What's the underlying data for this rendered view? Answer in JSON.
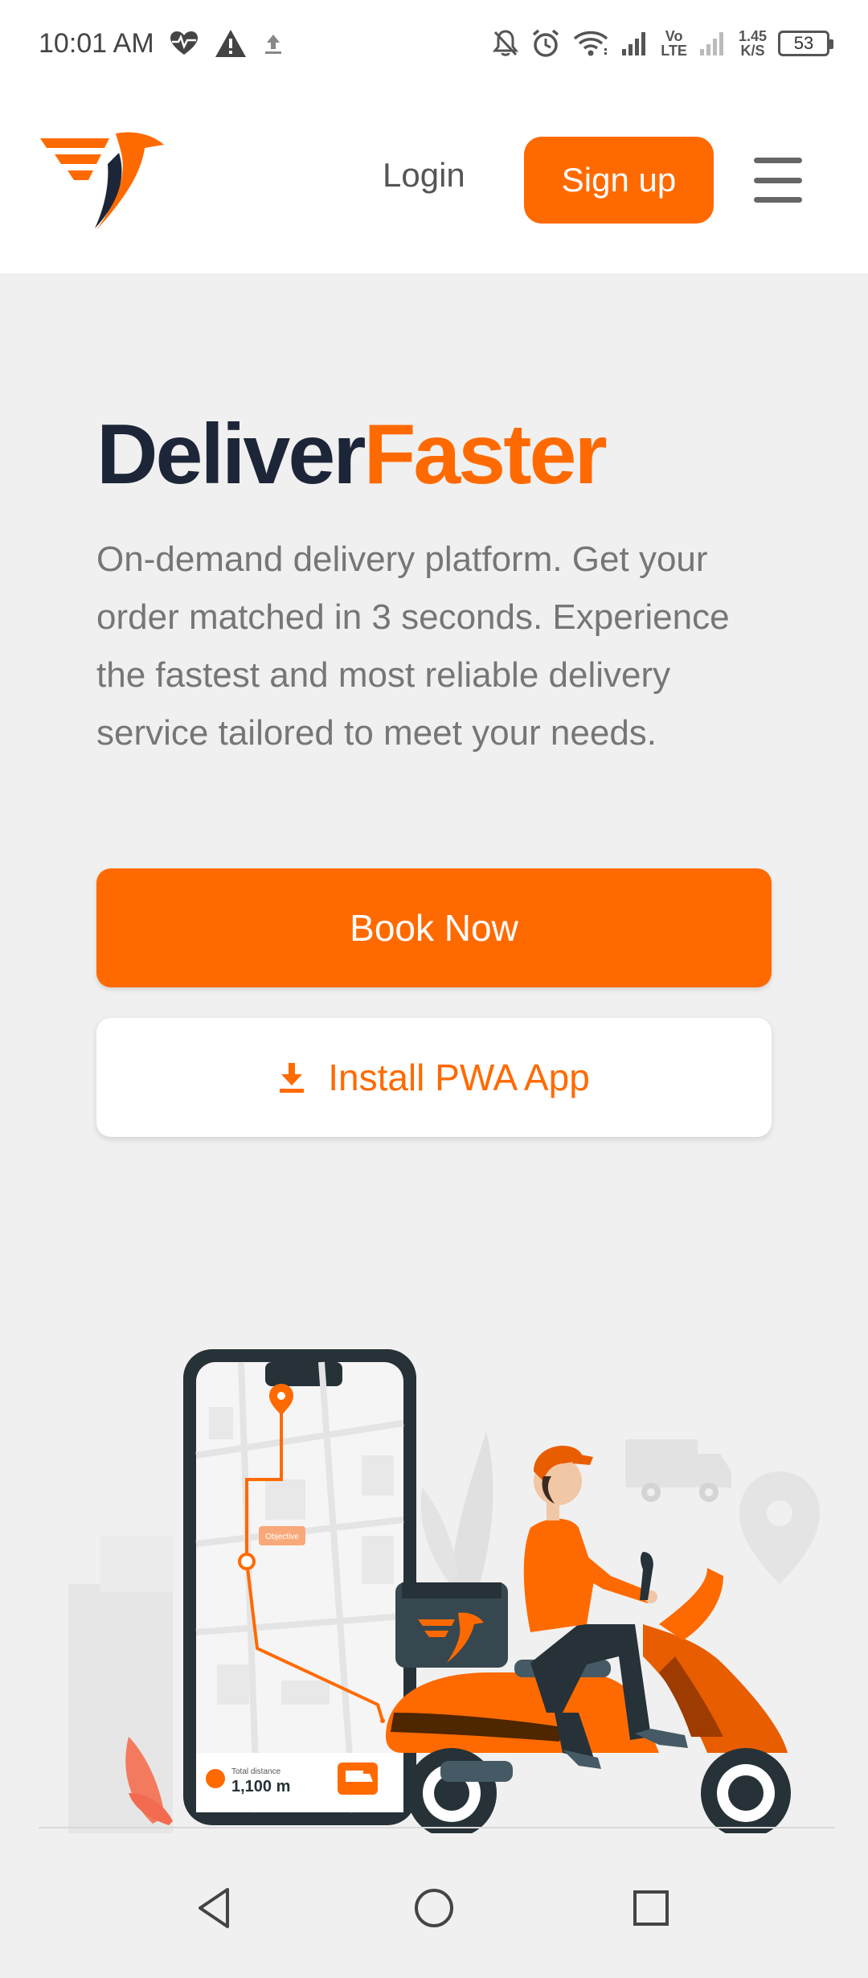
{
  "status_bar": {
    "time": "10:01 AM",
    "network_speed_value": "1.45",
    "network_speed_unit": "K/S",
    "battery_level": "53",
    "volte_label_top": "Vo",
    "volte_label_bottom": "LTE"
  },
  "header": {
    "login_label": "Login",
    "signup_label": "Sign up"
  },
  "hero": {
    "title_part1": "Deliver",
    "title_part2": "Faster",
    "description": "On-demand delivery platform. Get your order matched in 3 seconds. Experience the fastest and most reliable delivery service tailored to meet your needs.",
    "book_label": "Book Now",
    "install_label": "Install PWA App"
  },
  "illustration": {
    "map_label": "Objective",
    "distance_label": "Total distance",
    "distance_value": "1,100 m"
  },
  "colors": {
    "accent": "#ff6a00",
    "navy": "#1c2638",
    "text_gray": "#767676",
    "background": "#f0f0f0"
  },
  "icons": {
    "logo": "bird-logo-icon",
    "install": "download-icon",
    "menu": "hamburger-menu-icon"
  }
}
